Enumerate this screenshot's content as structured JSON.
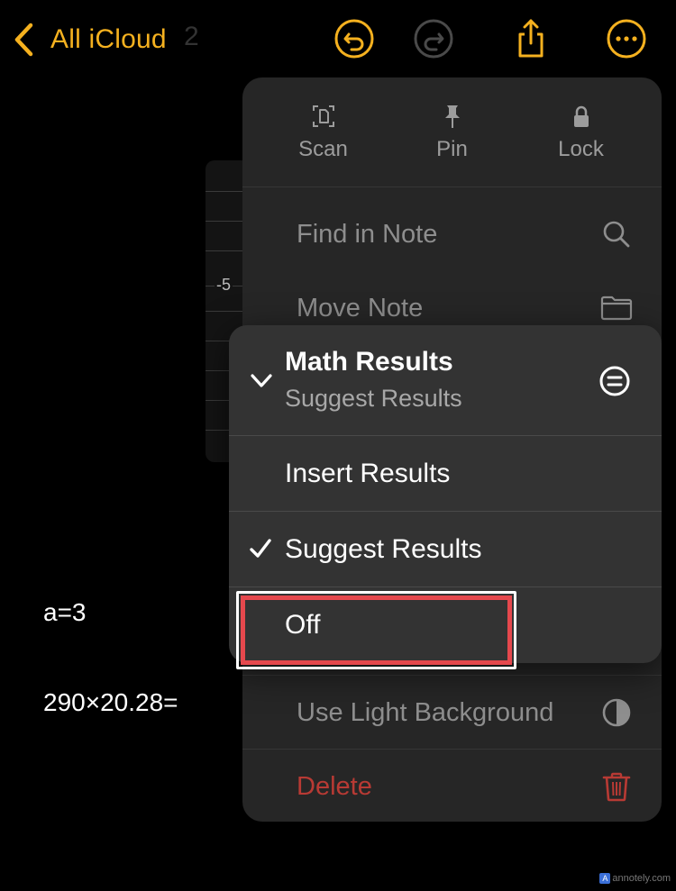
{
  "nav": {
    "back_label": "All iCloud",
    "ghost_text": "2"
  },
  "toolbar": {
    "icons": [
      "undo-icon",
      "redo-icon",
      "share-icon",
      "more-icon"
    ],
    "accent_color": "#f5b11f"
  },
  "note": {
    "graph_tick": "-5",
    "line_1": "a=3",
    "line_2": "290×20.28="
  },
  "menu": {
    "quick_actions": [
      {
        "label": "Scan",
        "icon": "scan-document-icon"
      },
      {
        "label": "Pin",
        "icon": "pin-icon"
      },
      {
        "label": "Lock",
        "icon": "lock-icon"
      }
    ],
    "find_in_note": {
      "label": "Find in Note",
      "icon": "magnifier-icon"
    },
    "move_note": {
      "label": "Move Note",
      "icon": "folder-icon"
    },
    "use_light_background": {
      "label": "Use Light Background",
      "icon": "half-circle-icon"
    },
    "delete": {
      "label": "Delete",
      "icon": "trash-icon",
      "color": "#b83a34"
    }
  },
  "submenu": {
    "title": "Math Results",
    "subtitle": "Suggest Results",
    "items": [
      {
        "label": "Insert Results",
        "checked": false
      },
      {
        "label": "Suggest Results",
        "checked": true
      },
      {
        "label": "Off",
        "checked": false
      }
    ],
    "highlight_color": "#e5484d"
  },
  "watermark": {
    "logo": "A",
    "text": "annotely.com"
  }
}
